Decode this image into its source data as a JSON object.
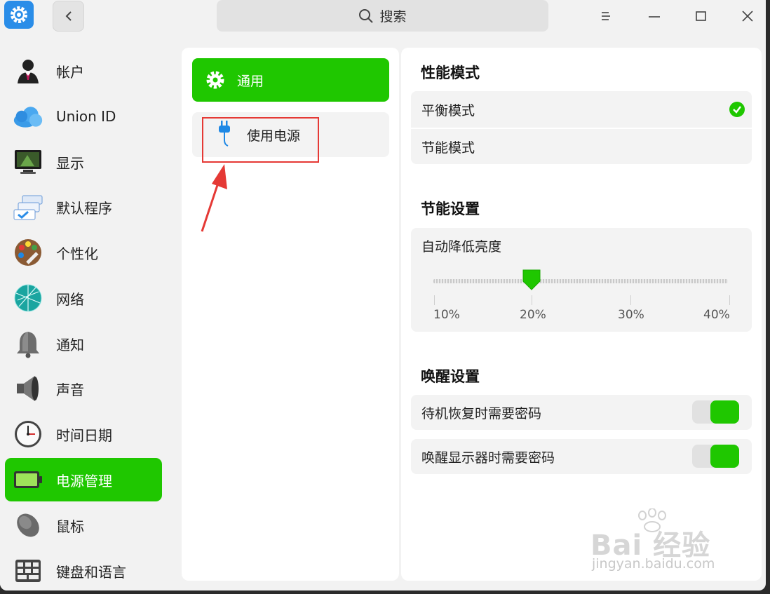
{
  "titlebar": {
    "search_placeholder": "搜索",
    "icons": [
      "settings-gear-icon",
      "back-chevron-icon",
      "search-icon",
      "menu-icon",
      "minimize-icon",
      "maximize-icon",
      "close-icon"
    ]
  },
  "nav": {
    "items": [
      {
        "label": "帐户",
        "icon": "account-avatar-icon",
        "active": false
      },
      {
        "label": "Union ID",
        "icon": "cloud-icon",
        "active": false
      },
      {
        "label": "显示",
        "icon": "monitor-icon",
        "active": false
      },
      {
        "label": "默认程序",
        "icon": "default-apps-icon",
        "active": false
      },
      {
        "label": "个性化",
        "icon": "palette-icon",
        "active": false
      },
      {
        "label": "网络",
        "icon": "network-globe-icon",
        "active": false
      },
      {
        "label": "通知",
        "icon": "bell-icon",
        "active": false
      },
      {
        "label": "声音",
        "icon": "speaker-icon",
        "active": false
      },
      {
        "label": "时间日期",
        "icon": "clock-icon",
        "active": false
      },
      {
        "label": "电源管理",
        "icon": "battery-icon",
        "active": true
      },
      {
        "label": "鼠标",
        "icon": "mouse-icon",
        "active": false
      },
      {
        "label": "键盘和语言",
        "icon": "keyboard-icon",
        "active": false
      }
    ]
  },
  "middle": {
    "items": [
      {
        "label": "通用",
        "icon": "gear-icon",
        "active": true
      },
      {
        "label": "使用电源",
        "icon": "power-plug-icon",
        "active": false
      }
    ]
  },
  "right": {
    "performance": {
      "title": "性能模式",
      "options": [
        {
          "label": "平衡模式",
          "selected": true
        },
        {
          "label": "节能模式",
          "selected": false
        }
      ]
    },
    "saving": {
      "title": "节能设置",
      "brightness_label": "自动降低亮度",
      "ticks": [
        "10%",
        "20%",
        "30%",
        "40%"
      ],
      "value": "20%"
    },
    "wake": {
      "title": "唤醒设置",
      "toggles": [
        {
          "label": "待机恢复时需要密码",
          "on": true
        },
        {
          "label": "唤醒显示器时需要密码",
          "on": true
        }
      ]
    }
  },
  "watermark": {
    "main": "Bai 经验",
    "sub": "jingyan.baidu.com"
  },
  "colors": {
    "accent": "#1fc700",
    "annotation": "#e53935",
    "app_icon": "#2a8de8"
  }
}
